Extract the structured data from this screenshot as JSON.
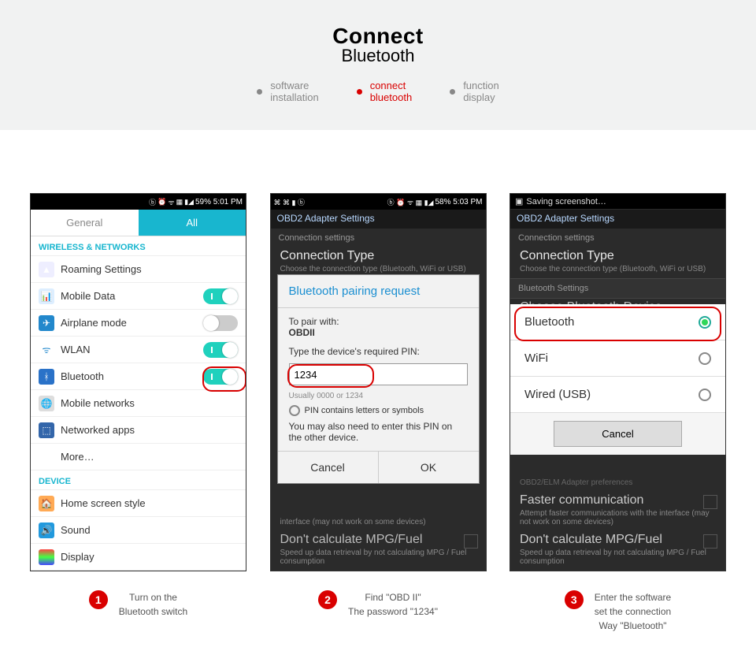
{
  "banner": {
    "title": "Connect",
    "subtitle": "Bluetooth",
    "tabs": [
      {
        "l1": "software",
        "l2": "installation"
      },
      {
        "l1": "connect",
        "l2": "bluetooth"
      },
      {
        "l1": "function",
        "l2": "display"
      }
    ]
  },
  "p1": {
    "status": "59%   5:01 PM",
    "tab_general": "General",
    "tab_all": "All",
    "hdr_net": "WIRELESS & NETWORKS",
    "r_roaming": "Roaming Settings",
    "r_mobile": "Mobile Data",
    "r_air": "Airplane mode",
    "r_wlan": "WLAN",
    "r_bt": "Bluetooth",
    "r_mnet": "Mobile networks",
    "r_apps": "Networked apps",
    "r_more": "More…",
    "hdr_dev": "DEVICE",
    "r_home": "Home screen style",
    "r_sound": "Sound",
    "r_disp": "Display"
  },
  "p2": {
    "status": "58%   5:03 PM",
    "appbar": "OBD2 Adapter Settings",
    "sec": "Connection settings",
    "ct": "Connection Type",
    "ctsub": "Choose the connection type (Bluetooth, WiFi or USB)",
    "dlg_h": "Bluetooth pairing request",
    "pair_lbl": "To pair with:",
    "pair_dev": "OBDII",
    "pin_lbl": "Type the device's required PIN:",
    "pin_val": "1234",
    "hint": "Usually 0000 or 1234",
    "chk": "PIN contains letters or symbols",
    "note": "You may also need to enter this PIN on the other device.",
    "cancel": "Cancel",
    "ok": "OK",
    "bg1": "interface (may not work on some devices)",
    "bg2": "Don't calculate MPG/Fuel",
    "bg3": "Speed up data retrieval by not calculating MPG / Fuel consumption"
  },
  "p3": {
    "saving": "Saving screenshot…",
    "appbar": "OBD2 Adapter Settings",
    "sec": "Connection settings",
    "ct": "Connection Type",
    "ctsub": "Choose the connection type (Bluetooth, WiFi or USB)",
    "btset": "Bluetooth Settings",
    "choose": "Choose Bluetooth Device",
    "opt_bt": "Bluetooth",
    "opt_wifi": "WiFi",
    "opt_usb": "Wired (USB)",
    "cancel": "Cancel",
    "f1": "Faster communication",
    "f1s": "Attempt faster communications with the interface (may not work on some devices)",
    "f2": "Don't calculate MPG/Fuel",
    "f2s": "Speed up data retrieval by not calculating MPG / Fuel consumption",
    "adapter_pref": "OBD2/ELM Adapter preferences"
  },
  "cap": {
    "n1": "1",
    "t1a": "Turn on the",
    "t1b": "Bluetooth switch",
    "n2": "2",
    "t2a": "Find  \"OBD II\"",
    "t2b": "The password \"1234\"",
    "n3": "3",
    "t3a": "Enter the software",
    "t3b": "set the connection",
    "t3c": "Way \"Bluetooth\""
  }
}
